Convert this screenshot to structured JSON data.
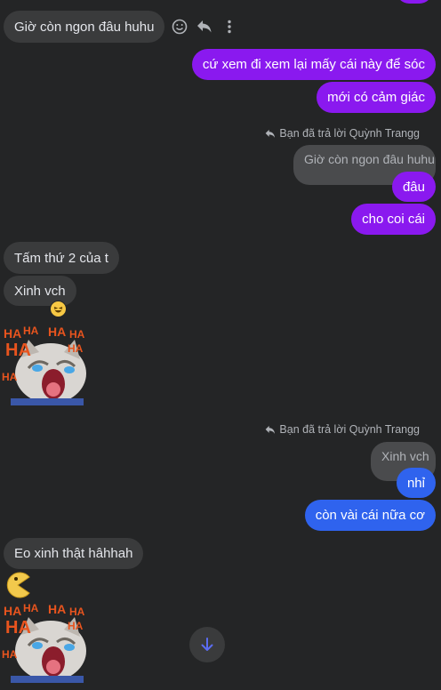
{
  "messages": {
    "m1": "Giờ còn ngon đâu huhu",
    "m2": "cứ xem đi xem lại mấy cái này để sóc",
    "m3": "mới có cảm giác",
    "reply1_label": "Bạn đã trả lời Quỳnh Trangg",
    "reply1_quote": "Giờ còn ngon đâu huhu",
    "m4": "đâu",
    "m5": "cho coi cái",
    "m6": "Tấm thứ 2 của t",
    "m7": "Xinh vch",
    "reply2_label": "Bạn đã trả lời Quỳnh Trangg",
    "reply2_quote": "Xinh vch",
    "m8": "nhỉ",
    "m9": "còn vài cái nữa cơ",
    "m10": "Eo xinh thật hâhhah"
  },
  "sticker_text": "HA",
  "icons": {
    "react": "smiley-icon",
    "reply": "reply-icon",
    "more": "more-vertical-icon",
    "reaction": "laughing-emoji-icon",
    "pacman": "pacman-emoji-icon",
    "scroll": "arrow-down-icon"
  },
  "colors": {
    "background": "#242526",
    "incoming": "#3a3b3c",
    "outgoing_purple": "#8a19ef",
    "outgoing_blue": "#2f63ee"
  }
}
